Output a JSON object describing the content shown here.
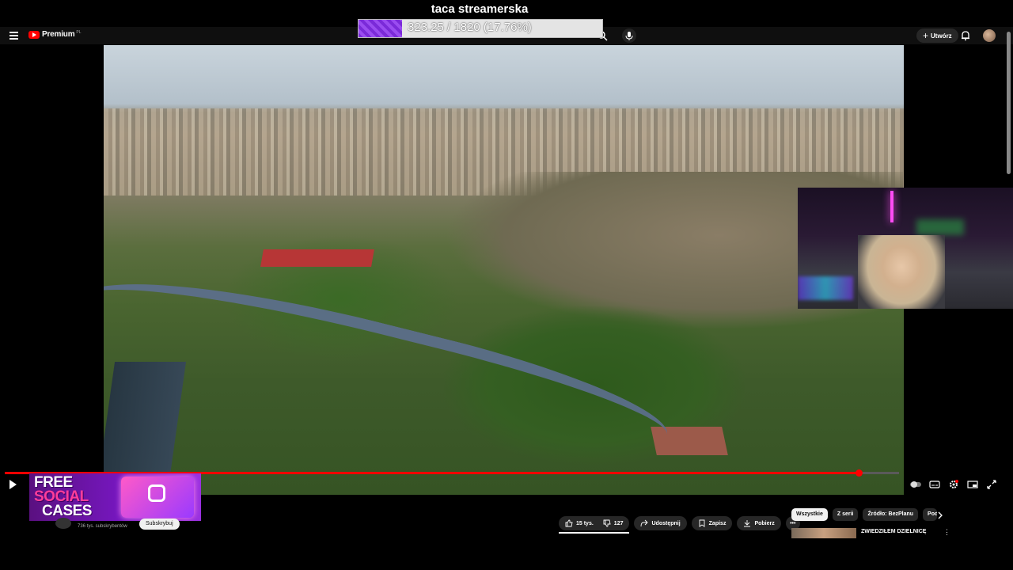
{
  "topbar": {
    "brand": "Premium",
    "region": "PL",
    "create_label": "Utwórz"
  },
  "overlay": {
    "title": "taca streamerska",
    "progress_text": "323.25 / 1820 (17.76%)",
    "progress_fraction": 0.1776,
    "fill_color": "#8a3ae6"
  },
  "player": {
    "progress_fraction": 0.955,
    "progress_color": "#ff0000"
  },
  "promo": {
    "line1": "FREE",
    "line2": "SOCIAL",
    "line3": "CASES"
  },
  "channel": {
    "subscribers": "736 tys. subskrybentów",
    "subscribe_label": "Subskrybuj"
  },
  "actions": {
    "likes": "15 tys.",
    "dislikes": "127",
    "share": "Udostępnij",
    "save": "Zapisz",
    "download": "Pobierz"
  },
  "chips": [
    "Wszystkie",
    "Z serii",
    "Źródło: BezPlanu",
    "Pod"
  ],
  "recommendation": {
    "title": "ZWIEDZIŁEM DZIELNICĘ"
  }
}
